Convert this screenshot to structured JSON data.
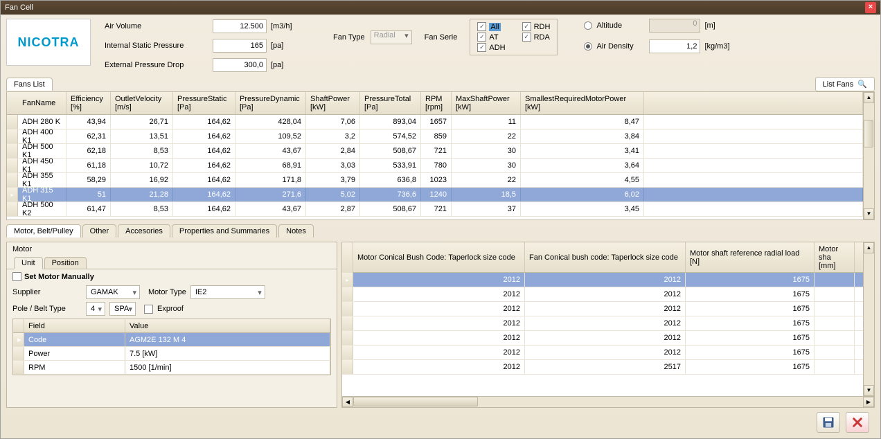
{
  "window": {
    "title": "Fan Cell"
  },
  "logo": "NICOTRA",
  "params": {
    "air_volume_label": "Air Volume",
    "air_volume_value": "12.500",
    "air_volume_unit": "[m3/h]",
    "isp_label": "Internal Static Pressure",
    "isp_value": "165",
    "isp_unit": "[pa]",
    "epd_label": "External Pressure Drop",
    "epd_value": "300,0",
    "epd_unit": "[pa]",
    "fan_type_label": "Fan Type",
    "fan_type_value": "Radial",
    "fan_serie_label": "Fan Serie",
    "series": {
      "all": "All",
      "at": "AT",
      "adh": "ADH",
      "rdh": "RDH",
      "rda": "RDA"
    },
    "altitude_label": "Altitude",
    "altitude_value": "0",
    "altitude_unit": "[m]",
    "air_density_label": "Air Density",
    "air_density_value": "1,2",
    "air_density_unit": "[kg/m3]"
  },
  "tabs": {
    "fans_list": "Fans List",
    "list_fans_btn": "List Fans"
  },
  "grid": {
    "headers": {
      "fanname": "FanName",
      "eff": "Efficiency",
      "eff_unit": "[%]",
      "outvel": "OutletVelocity",
      "outvel_unit": "[m/s]",
      "pstat": "PressureStatic",
      "pstat_unit": "[Pa]",
      "pdyn": "PressureDynamic",
      "pdyn_unit": "[Pa]",
      "shaft": "ShaftPower",
      "shaft_unit": "[kW]",
      "ptot": "PressureTotal",
      "ptot_unit": "[Pa]",
      "rpm": "RPM",
      "rpm_unit": "[rpm]",
      "maxshaft": "MaxShaftPower",
      "maxshaft_unit": "[kW]",
      "smallest": "SmallestRequiredMotorPower",
      "smallest_unit": "[kW]"
    },
    "rows": [
      {
        "name": "ADH 280 K",
        "eff": "43,94",
        "outvel": "26,71",
        "pstat": "164,62",
        "pdyn": "428,04",
        "shaft": "7,06",
        "ptot": "893,04",
        "rpm": "1657",
        "maxshaft": "11",
        "smallest": "8,47"
      },
      {
        "name": "ADH 400 K1",
        "eff": "62,31",
        "outvel": "13,51",
        "pstat": "164,62",
        "pdyn": "109,52",
        "shaft": "3,2",
        "ptot": "574,52",
        "rpm": "859",
        "maxshaft": "22",
        "smallest": "3,84"
      },
      {
        "name": "ADH 500 K1",
        "eff": "62,18",
        "outvel": "8,53",
        "pstat": "164,62",
        "pdyn": "43,67",
        "shaft": "2,84",
        "ptot": "508,67",
        "rpm": "721",
        "maxshaft": "30",
        "smallest": "3,41"
      },
      {
        "name": "ADH 450 K1",
        "eff": "61,18",
        "outvel": "10,72",
        "pstat": "164,62",
        "pdyn": "68,91",
        "shaft": "3,03",
        "ptot": "533,91",
        "rpm": "780",
        "maxshaft": "30",
        "smallest": "3,64"
      },
      {
        "name": "ADH 355 K1",
        "eff": "58,29",
        "outvel": "16,92",
        "pstat": "164,62",
        "pdyn": "171,8",
        "shaft": "3,79",
        "ptot": "636,8",
        "rpm": "1023",
        "maxshaft": "22",
        "smallest": "4,55"
      },
      {
        "name": "ADH 315 K1",
        "eff": "51",
        "outvel": "21,28",
        "pstat": "164,62",
        "pdyn": "271,6",
        "shaft": "5,02",
        "ptot": "736,6",
        "rpm": "1240",
        "maxshaft": "18,5",
        "smallest": "6,02",
        "selected": true
      },
      {
        "name": "ADH 500 K2",
        "eff": "61,47",
        "outvel": "8,53",
        "pstat": "164,62",
        "pdyn": "43,67",
        "shaft": "2,87",
        "ptot": "508,67",
        "rpm": "721",
        "maxshaft": "37",
        "smallest": "3,45"
      }
    ]
  },
  "detail_tabs": {
    "motor_belt": "Motor, Belt/Pulley",
    "other": "Other",
    "accessories": "Accesories",
    "props": "Properties and Summaries",
    "notes": "Notes"
  },
  "motor": {
    "legend": "Motor",
    "unit_tab": "Unit",
    "position_tab": "Position",
    "set_manually": "Set Motor Manually",
    "supplier_label": "Supplier",
    "supplier_value": "GAMAK",
    "motor_type_label": "Motor Type",
    "motor_type_value": "IE2",
    "pole_label": "Pole / Belt Type",
    "pole_value": "4",
    "belt_value": "SPA",
    "exproof": "Exproof",
    "field_header": "Field",
    "value_header": "Value",
    "rows": [
      {
        "field": "Code",
        "value": "AGM2E 132 M 4",
        "selected": true
      },
      {
        "field": "Power",
        "value": "7.5 [kW]"
      },
      {
        "field": "RPM",
        "value": "1500 [1/min]"
      }
    ]
  },
  "right_grid": {
    "headers": {
      "motor_bush": "Motor Conical Bush Code: Taperlock    size code",
      "fan_bush": "Fan Conical bush code: Taperlock    size code",
      "radial": "Motor shaft reference radial load",
      "radial_unit": "[N]",
      "shaft": "Motor sha",
      "shaft_unit": "[mm]"
    },
    "rows": [
      {
        "motor": "2012",
        "fan": "2012",
        "radial": "1675",
        "selected": true
      },
      {
        "motor": "2012",
        "fan": "2012",
        "radial": "1675"
      },
      {
        "motor": "2012",
        "fan": "2012",
        "radial": "1675"
      },
      {
        "motor": "2012",
        "fan": "2012",
        "radial": "1675"
      },
      {
        "motor": "2012",
        "fan": "2012",
        "radial": "1675"
      },
      {
        "motor": "2012",
        "fan": "2012",
        "radial": "1675"
      },
      {
        "motor": "2012",
        "fan": "2517",
        "radial": "1675"
      }
    ]
  }
}
